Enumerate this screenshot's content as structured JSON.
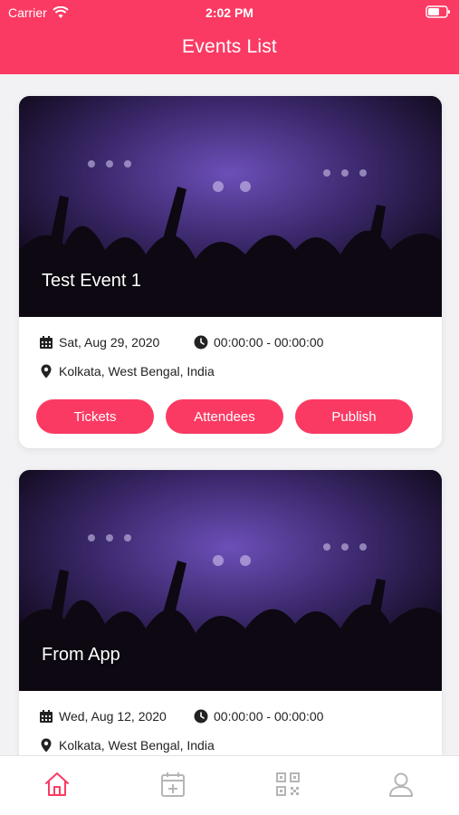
{
  "status_bar": {
    "carrier": "Carrier",
    "time": "2:02 PM"
  },
  "header": {
    "title": "Events List"
  },
  "events": [
    {
      "name": "Test Event 1",
      "date": "Sat, Aug 29, 2020",
      "time": "00:00:00 - 00:00:00",
      "location": "Kolkata, West Bengal, India",
      "buttons": [
        "Tickets",
        "Attendees",
        "Publish"
      ]
    },
    {
      "name": "From App",
      "date": "Wed, Aug 12, 2020",
      "time": "00:00:00 - 00:00:00",
      "location": "Kolkata, West Bengal, India"
    }
  ],
  "tabbar": {
    "items": [
      {
        "icon": "home-icon",
        "active": true
      },
      {
        "icon": "calendar-add-icon",
        "active": false
      },
      {
        "icon": "qr-code-icon",
        "active": false
      },
      {
        "icon": "user-icon",
        "active": false
      }
    ]
  },
  "colors": {
    "accent": "#fb3a63",
    "tab_inactive": "#b5b5b8",
    "background": "#f2f2f4"
  }
}
